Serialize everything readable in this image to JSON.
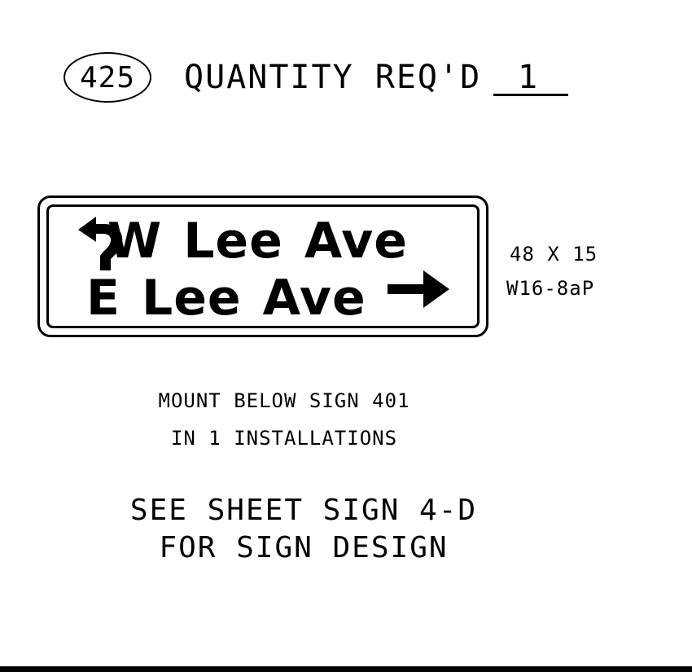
{
  "header": {
    "sign_number": "425",
    "quantity_label": "QUANTITY REQ'D",
    "quantity_value": "1"
  },
  "sign": {
    "line1": {
      "arrow_icon": "left-turn-arrow-icon",
      "text_part1": "W",
      "text_part2": "Lee",
      "text_part3": "Ave"
    },
    "line2": {
      "text_part1": "E",
      "text_part2": "Lee",
      "text_part3": "Ave",
      "arrow_icon": "right-arrow-icon"
    },
    "size": "48 X 15",
    "code": "W16-8aP"
  },
  "notes": {
    "mount_line1": "MOUNT BELOW SIGN 401",
    "mount_line2": "IN 1 INSTALLATIONS",
    "design_line1": "SEE SHEET SIGN 4-D",
    "design_line2": "FOR SIGN DESIGN"
  },
  "colors": {
    "ink": "#000000",
    "background": "#ffffff"
  }
}
